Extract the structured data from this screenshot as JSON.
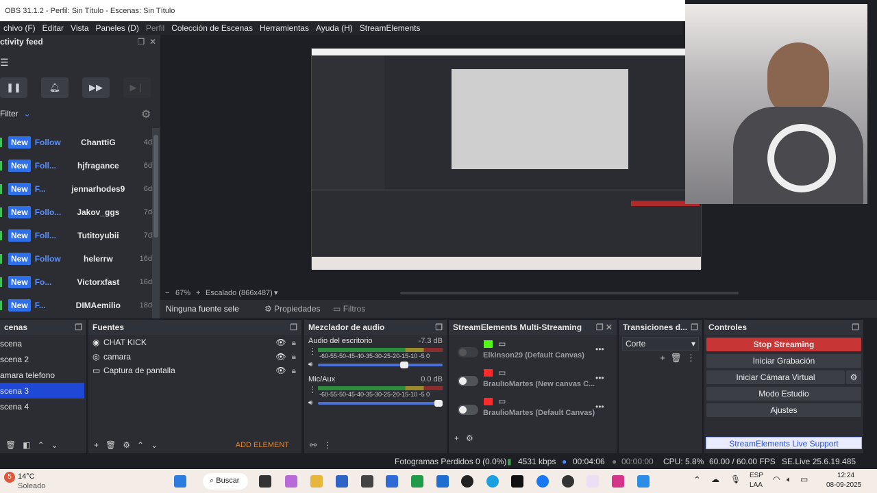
{
  "title": "OBS 31.1.2 - Perfil: Sin Título - Escenas: Sin Título",
  "menu": [
    "chivo (F)",
    "Editar",
    "Vista",
    "Paneles (D)",
    "Perfil",
    "Colección de Escenas",
    "Herramientas",
    "Ayuda (H)",
    "StreamElements"
  ],
  "feed": {
    "title": "ctivity feed",
    "filter": "Filter",
    "rows": [
      {
        "tag": "New",
        "type": "Follow",
        "name": "ChanttiG",
        "age": "4d"
      },
      {
        "tag": "New",
        "type": "Foll...",
        "name": "hjfragance",
        "age": "6d"
      },
      {
        "tag": "New",
        "type": "F...",
        "name": "jennarhodes9",
        "age": "6d"
      },
      {
        "tag": "New",
        "type": "Follo...",
        "name": "Jakov_ggs",
        "age": "7d"
      },
      {
        "tag": "New",
        "type": "Foll...",
        "name": "Tutitoyubii",
        "age": "7d"
      },
      {
        "tag": "New",
        "type": "Follow",
        "name": "helerrw",
        "age": "16d"
      },
      {
        "tag": "New",
        "type": "Fo...",
        "name": "Victorxfast",
        "age": "16d"
      },
      {
        "tag": "New",
        "type": "F...",
        "name": "DIMAemilio",
        "age": "18d"
      }
    ]
  },
  "zoom": {
    "pct": "67%",
    "scaled": "Escalado (866x487)"
  },
  "source_bar": {
    "none": "Ninguna fuente sele",
    "props": "Propiedades",
    "filters": "Filtros"
  },
  "scenes": {
    "title": "cenas",
    "items": [
      "scena",
      "scena 2",
      "amara telefono",
      "scena 3",
      "scena 4"
    ],
    "selected": 3
  },
  "sources": {
    "title": "Fuentes",
    "items": [
      "CHAT KICK",
      "camara",
      "Captura de pantalla"
    ],
    "add": "ADD ELEMENT"
  },
  "mixer": {
    "title": "Mezclador de audio",
    "channels": [
      {
        "name": "Audio del escritorio",
        "db": "-7.3 dB"
      },
      {
        "name": "Mic/Aux",
        "db": "0.0 dB"
      }
    ],
    "scale": "-60-55-50-45-40-35-30-25-20-15-10 -5 0"
  },
  "multistream": {
    "title": "StreamElements Multi-Streaming",
    "items": [
      "Elkinson29 (Default Canvas)",
      "BraulioMartes (New canvas C...",
      "BraulioMartes (Default Canvas)"
    ]
  },
  "transitions": {
    "title": "Transiciones d...",
    "value": "Corte"
  },
  "controls": {
    "title": "Controles",
    "stop": "Stop Streaming",
    "record": "Iniciar Grabación",
    "vcam": "Iniciar Cámara Virtual",
    "studio": "Modo Estudio",
    "settings": "Ajustes",
    "support": "StreamElements Live Support"
  },
  "status": {
    "dropped": "Fotogramas Perdidos 0 (0.0%)",
    "kbps": "4531 kbps",
    "stream_time": "00:04:06",
    "rec_time": "00:00:00",
    "cpu": "CPU: 5.8%",
    "fps": "60.00 / 60.00 FPS",
    "version": "SE.Live 25.6.19.485"
  },
  "taskbar": {
    "temp": "14°C",
    "weather": "Soleado",
    "search": "Buscar",
    "lang1": "ESP",
    "lang2": "LAA",
    "time": "12:24",
    "date": "08-09-2025",
    "badge": "5"
  }
}
